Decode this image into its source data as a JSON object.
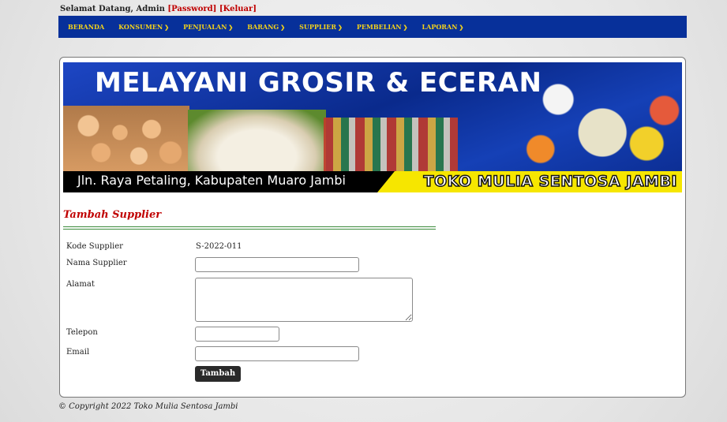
{
  "header": {
    "welcome_prefix": "Selamat Datang, Admin",
    "password_link": "Password",
    "logout_link": "Keluar"
  },
  "nav": [
    {
      "label": "BERANDA",
      "dropdown": false
    },
    {
      "label": "KONSUMEN",
      "dropdown": true
    },
    {
      "label": "PENJUALAN",
      "dropdown": true
    },
    {
      "label": "BARANG",
      "dropdown": true
    },
    {
      "label": "SUPPLIER",
      "dropdown": true
    },
    {
      "label": "PEMBELIAN",
      "dropdown": true
    },
    {
      "label": "LAPORAN",
      "dropdown": true
    }
  ],
  "banner": {
    "title": "MELAYANI GROSIR & ECERAN",
    "address": "Jln. Raya Petaling, Kabupaten Muaro Jambi",
    "store": "TOKO MULIA SENTOSA JAMBI"
  },
  "form": {
    "title": "Tambah Supplier",
    "kode_label": "Kode Supplier",
    "kode_value": "S-2022-011",
    "nama_label": "Nama Supplier",
    "nama_value": "",
    "alamat_label": "Alamat",
    "alamat_value": "",
    "telepon_label": "Telepon",
    "telepon_value": "",
    "email_label": "Email",
    "email_value": "",
    "submit_label": "Tambah"
  },
  "footer": {
    "copyright": "© Copyright 2022 Toko Mulia Sentosa Jambi"
  },
  "colors": {
    "nav_bg": "#07309a",
    "nav_text": "#f3d21b",
    "accent_red": "#c00000",
    "banner_yellow": "#f6e600"
  }
}
